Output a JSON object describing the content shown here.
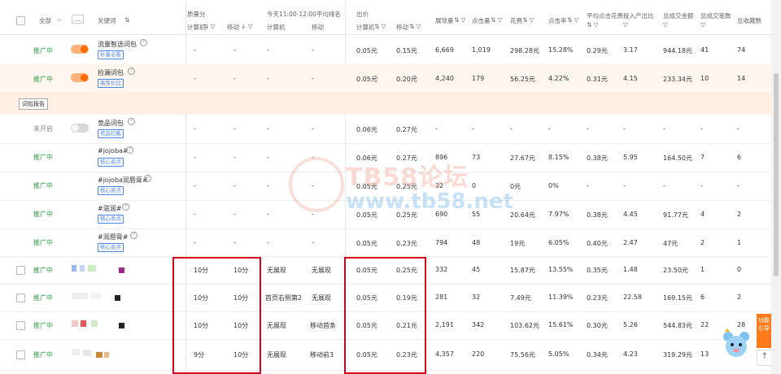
{
  "header": {
    "all_label": "全部",
    "more_label": "...",
    "keyword_col": "关键词",
    "quality_group": "质量分",
    "rank_group": "今天11:00-12:00平均排名",
    "bid_group": "出价",
    "sub_pc": "计算机",
    "sub_mobile": "移动",
    "impressions": "展现量",
    "clicks": "点击量",
    "cost": "花费",
    "ctr": "点击率",
    "avg_cpc": "平均点击花费",
    "roi": "投入产出比",
    "total_gmv": "总成交金额",
    "total_orders": "总成交笔数",
    "total_fav": "总收藏数"
  },
  "report_button": "词包报告",
  "rows": [
    {
      "status": "推广中",
      "toggle": "on",
      "keyword": "流量智选词包",
      "tag": "补量必看",
      "q_pc": "-",
      "q_mob": "-",
      "r_pc": "-",
      "r_mob": "-",
      "bid_pc": "0.05元",
      "bid_mob": "0.15元",
      "imp": "6,669",
      "clk": "1,019",
      "cost": "298.28元",
      "ctr": "15.28%",
      "cpc": "0.29元",
      "roi": "3.17",
      "gmv": "944.18元",
      "orders": "41",
      "fav": "74"
    },
    {
      "status": "推广中",
      "toggle": "on",
      "keyword": "捡漏词包",
      "tag": "高性价比",
      "q_pc": "-",
      "q_mob": "-",
      "r_pc": "-",
      "r_mob": "-",
      "bid_pc": "0.05元",
      "bid_mob": "0.20元",
      "imp": "4,240",
      "clk": "179",
      "cost": "56.25元",
      "ctr": "4.22%",
      "cpc": "0.31元",
      "roi": "4.15",
      "gmv": "233.34元",
      "orders": "10",
      "fav": "14"
    },
    {
      "status": "未开启",
      "toggle": "off",
      "keyword": "竞品词包",
      "tag": "竞品拦截",
      "q_pc": "-",
      "q_mob": "-",
      "r_pc": "-",
      "r_mob": "-",
      "bid_pc": "0.06元",
      "bid_mob": "0.27元",
      "imp": "-",
      "clk": "-",
      "cost": "-",
      "ctr": "-",
      "cpc": "-",
      "roi": "-",
      "gmv": "-",
      "orders": "-",
      "fav": "-"
    },
    {
      "status": "推广中",
      "toggle": "",
      "keyword": "#jojoba#",
      "tag": "核心卖点",
      "q_pc": "-",
      "q_mob": "-",
      "r_pc": "-",
      "r_mob": "-",
      "bid_pc": "0.06元",
      "bid_mob": "0.27元",
      "imp": "896",
      "clk": "73",
      "cost": "27.67元",
      "ctr": "8.15%",
      "cpc": "0.38元",
      "roi": "5.95",
      "gmv": "164.50元",
      "orders": "7",
      "fav": "6"
    },
    {
      "status": "推广中",
      "toggle": "",
      "keyword": "#jojoba润唇膏#",
      "tag": "核心卖点",
      "q_pc": "-",
      "q_mob": "-",
      "r_pc": "-",
      "r_mob": "-",
      "bid_pc": "0.05元",
      "bid_mob": "0.25元",
      "imp": "32",
      "clk": "0",
      "cost": "0元",
      "ctr": "0%",
      "cpc": "-",
      "roi": "-",
      "gmv": "-",
      "orders": "-",
      "fav": "-"
    },
    {
      "status": "推广中",
      "toggle": "",
      "keyword": "#滋润#",
      "tag": "核心卖点",
      "q_pc": "-",
      "q_mob": "-",
      "r_pc": "-",
      "r_mob": "-",
      "bid_pc": "0.05元",
      "bid_mob": "0.25元",
      "imp": "690",
      "clk": "55",
      "cost": "20.64元",
      "ctr": "7.97%",
      "cpc": "0.38元",
      "roi": "4.45",
      "gmv": "91.77元",
      "orders": "4",
      "fav": "2"
    },
    {
      "status": "推广中",
      "toggle": "",
      "keyword": "#润唇膏#",
      "tag": "核心卖点",
      "q_pc": "-",
      "q_mob": "-",
      "r_pc": "-",
      "r_mob": "-",
      "bid_pc": "0.05元",
      "bid_mob": "0.23元",
      "imp": "794",
      "clk": "48",
      "cost": "19元",
      "ctr": "6.05%",
      "cpc": "0.40元",
      "roi": "2.47",
      "gmv": "47元",
      "orders": "2",
      "fav": "1"
    },
    {
      "status": "推广中",
      "toggle": "",
      "keyword": "",
      "tag": "",
      "q_pc": "10分",
      "q_mob": "10分",
      "r_pc": "无展现",
      "r_mob": "无展现",
      "bid_pc": "0.05元",
      "bid_mob": "0.25元",
      "imp": "332",
      "clk": "45",
      "cost": "15.87元",
      "ctr": "13.55%",
      "cpc": "0.35元",
      "roi": "1.48",
      "gmv": "23.50元",
      "orders": "1",
      "fav": "0"
    },
    {
      "status": "推广中",
      "toggle": "",
      "keyword": "",
      "tag": "",
      "q_pc": "10分",
      "q_mob": "10分",
      "r_pc": "首页右侧第2",
      "r_mob": "无展现",
      "bid_pc": "0.05元",
      "bid_mob": "0.19元",
      "imp": "281",
      "clk": "32",
      "cost": "7.49元",
      "ctr": "11.39%",
      "cpc": "0.23元",
      "roi": "22.58",
      "gmv": "169.15元",
      "orders": "6",
      "fav": "2"
    },
    {
      "status": "推广中",
      "toggle": "",
      "keyword": "",
      "tag": "",
      "q_pc": "10分",
      "q_mob": "10分",
      "r_pc": "无展现",
      "r_mob": "移动首条",
      "bid_pc": "0.05元",
      "bid_mob": "0.21元",
      "imp": "2,191",
      "clk": "342",
      "cost": "103.62元",
      "ctr": "15.61%",
      "cpc": "0.30元",
      "roi": "5.26",
      "gmv": "544.83元",
      "orders": "22",
      "fav": "28"
    },
    {
      "status": "推广中",
      "toggle": "",
      "keyword": "",
      "tag": "",
      "q_pc": "9分",
      "q_mob": "10分",
      "r_pc": "无展现",
      "r_mob": "移动前3",
      "bid_pc": "0.05元",
      "bid_mob": "0.23元",
      "imp": "4,357",
      "clk": "220",
      "cost": "75.56元",
      "ctr": "5.05%",
      "cpc": "0.34元",
      "roi": "4.23",
      "gmv": "319.29元",
      "orders": "13",
      "fav": ""
    }
  ],
  "watermark": {
    "title": "TB58论坛",
    "url": "www.tb58.net"
  },
  "side_button": "功能引导",
  "colors": {
    "active_status": "#2ea043",
    "accent": "#ff6a00",
    "tag_blue": "#4c86e8",
    "highlight": "#d9001b"
  }
}
